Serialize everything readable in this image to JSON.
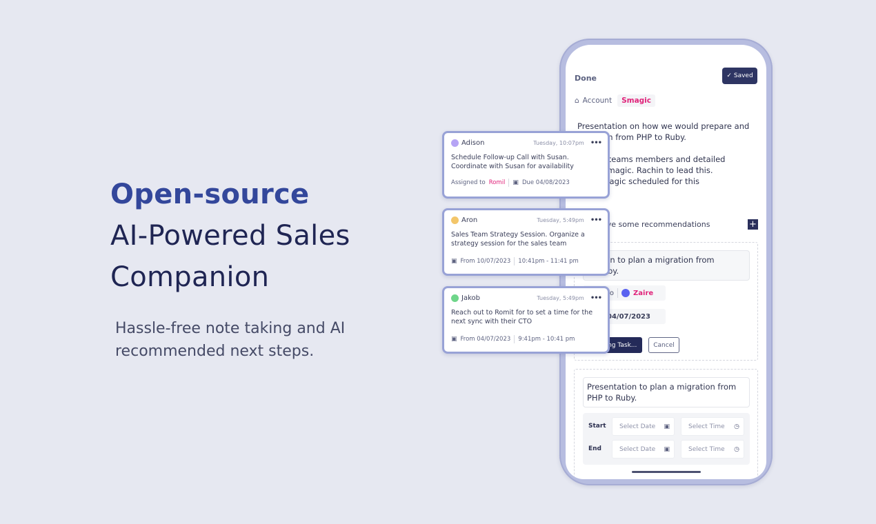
{
  "hero": {
    "line1": "Open-source",
    "line2": "AI-Powered Sales",
    "line3": "Companion",
    "subtitle": "Hassle-free note taking and AI recommended next steps."
  },
  "colors": {
    "brand_blue": "#33479b",
    "navy": "#1f2553",
    "accent_pink": "#e0237a",
    "button_dark": "#2e3563",
    "card_border": "#98a2d6"
  },
  "phone": {
    "done_label": "Done",
    "saved_label": "Saved",
    "account_label": "Account",
    "account_value": "Smagic",
    "note_text": "Presentation on how we would prepare and\n     nigration from PHP to Ruby.\n\n     nber of teams members and detailed\n     es for Smagic.  Rachin to lead this.\n     with Smagic scheduled for this\n     y 5 pm.",
    "recommendations_label": "ave some recommendations",
    "rec1": {
      "title": "atation to plan a migration from\nto Ruby.",
      "assigned_label": "to",
      "assignee": "Zaire",
      "due_value": "04/07/2023",
      "create_label": "ing Task...",
      "cancel_label": "Cancel"
    },
    "rec2": {
      "title": "Presentation to plan a migration from PHP to Ruby.",
      "start_label": "Start",
      "end_label": "End",
      "date_placeholder": "Select Date",
      "time_placeholder": "Select Time"
    }
  },
  "tasks": [
    {
      "user": "Adison",
      "avatar_color": "#b6a4f5",
      "time": "Tuesday, 10:07pm",
      "body": "Schedule Follow-up Call with Susan. Coordinate with Susan for availability",
      "assigned_label": "Assigned to",
      "assignee": "Romil",
      "due": "Due 04/08/2023"
    },
    {
      "user": "Aron",
      "avatar_color": "#f3c66a",
      "time": "Tuesday, 5:49pm",
      "body": "Sales Team Strategy Session. Organize a strategy session for the sales team",
      "from": "From 10/07/2023",
      "range": "10:41pm - 11:41 pm"
    },
    {
      "user": "Jakob",
      "avatar_color": "#6fd68a",
      "time": "Tuesday, 5:49pm",
      "body": "Reach out to Romit for to set a time for the next sync with their CTO",
      "from": "From 04/07/2023",
      "range": "9:41pm - 10:41 pm"
    }
  ],
  "icons": {
    "more": "•••",
    "check": "✓",
    "plus": "+",
    "calendar": "▣",
    "clock": "◷",
    "building": "⌂"
  }
}
